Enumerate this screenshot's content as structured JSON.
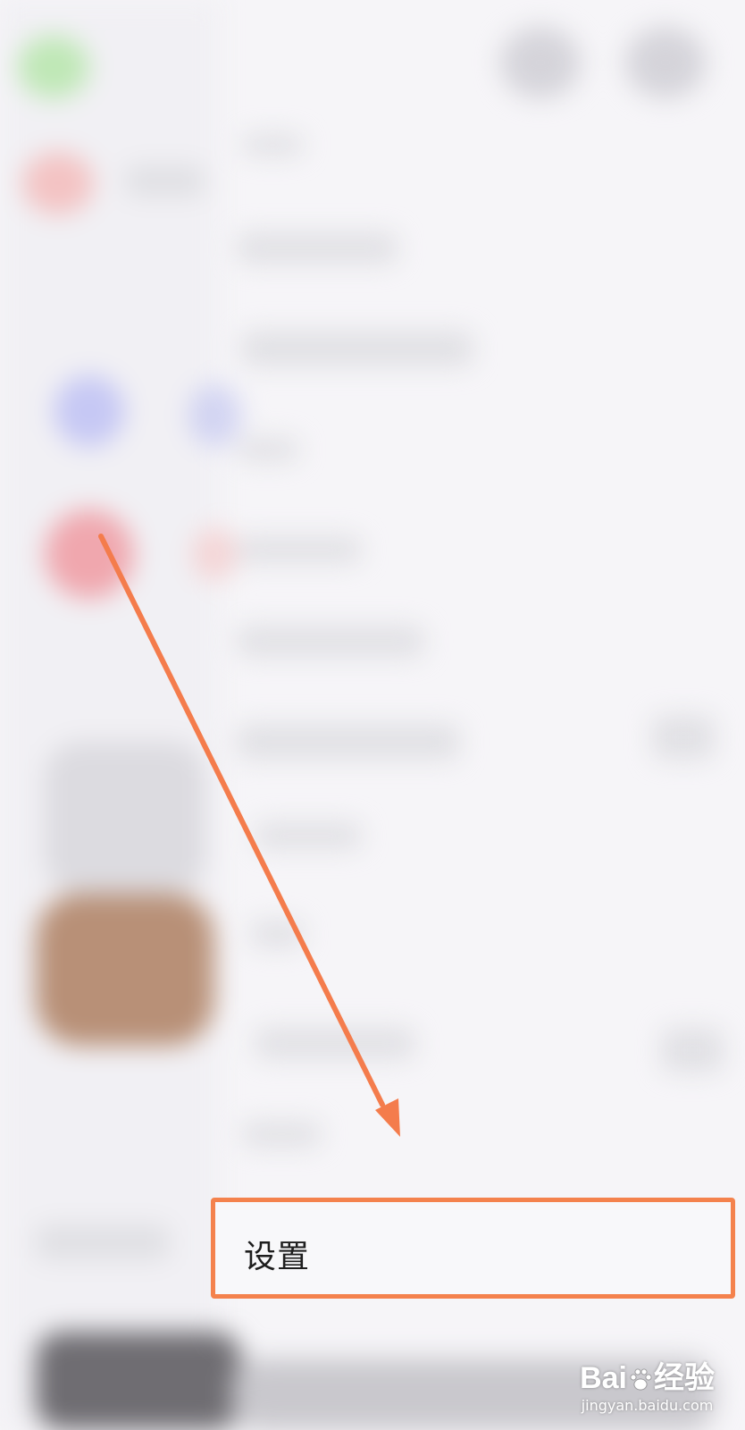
{
  "settings": {
    "label": "设置"
  },
  "watermark": {
    "logo_left": "Bai",
    "logo_right": "经验",
    "url": "jingyan.baidu.com"
  },
  "colors": {
    "highlight": "#f4824d",
    "arrow": "#f47c4c",
    "background": "#f6f5f8"
  },
  "icons": {
    "paw": "baidu-paw-icon",
    "arrow": "annotation-arrow"
  }
}
